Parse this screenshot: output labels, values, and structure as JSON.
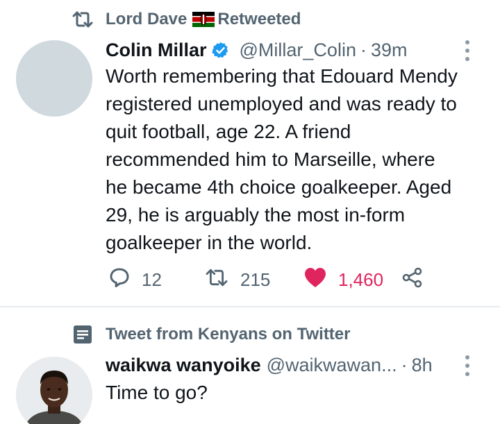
{
  "tweet1": {
    "retweeted_by": "Lord Dave",
    "retweeted_suffix": "Retweeted",
    "author_name": "Colin Millar",
    "author_handle": "@Millar_Colin",
    "separator": "·",
    "time": "39m",
    "text": "Worth remembering that Edouard Mendy\nregistered unemployed and was ready to\nquit football, age 22. A friend\nrecommended him to Marseille, where\nhe became 4th choice goalkeeper. Aged\n29, he is arguably the most in-form\ngoalkeeper in the world.",
    "reply_count": "12",
    "retweet_count": "215",
    "like_count": "1,460",
    "liked": true
  },
  "tweet2": {
    "context_label": "Tweet from Kenyans on Twitter",
    "author_name": "waikwa wanyoike",
    "author_handle": "@waikwawan...",
    "separator": "·",
    "time": "8h",
    "text": "Time to go?"
  },
  "colors": {
    "like": "#e0245e",
    "verified": "#1d9bf0",
    "secondary_text": "#536471",
    "divider": "#e6ecf0"
  },
  "icons": {
    "retweet_context": "retweet-icon",
    "flag": "kenya-flag-icon",
    "verified": "verified-badge-icon",
    "more": "more-vertical-icon",
    "reply": "reply-icon",
    "retweet": "retweet-icon",
    "like": "heart-filled-icon",
    "share": "share-icon",
    "topic": "list-icon"
  }
}
